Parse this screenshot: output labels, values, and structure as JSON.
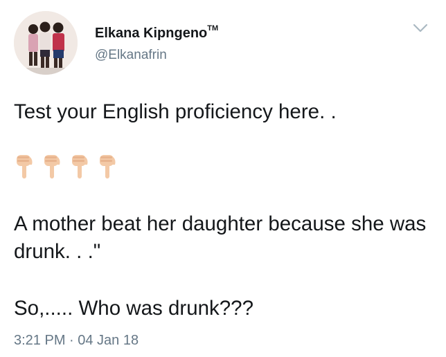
{
  "user": {
    "display_name": "Elkana Kipngeno",
    "badge": "TM",
    "handle": "@Elkanafrin"
  },
  "icons": {
    "avatar": "profile-photo-three-children",
    "menu": "chevron-down-icon",
    "emoji": "backhand-index-pointing-down"
  },
  "tweet": {
    "line1": "Test your English proficiency here. .",
    "emoji_count": 4,
    "line2": "A mother beat her daughter because she was drunk. . .\"",
    "line3": "So,..... Who was drunk???",
    "timestamp": "3:21 PM · 04 Jan 18"
  },
  "colors": {
    "text": "#14171a",
    "secondary": "#657786",
    "chevron": "#aab8c2",
    "emoji_skin": "#f3c9a6"
  }
}
